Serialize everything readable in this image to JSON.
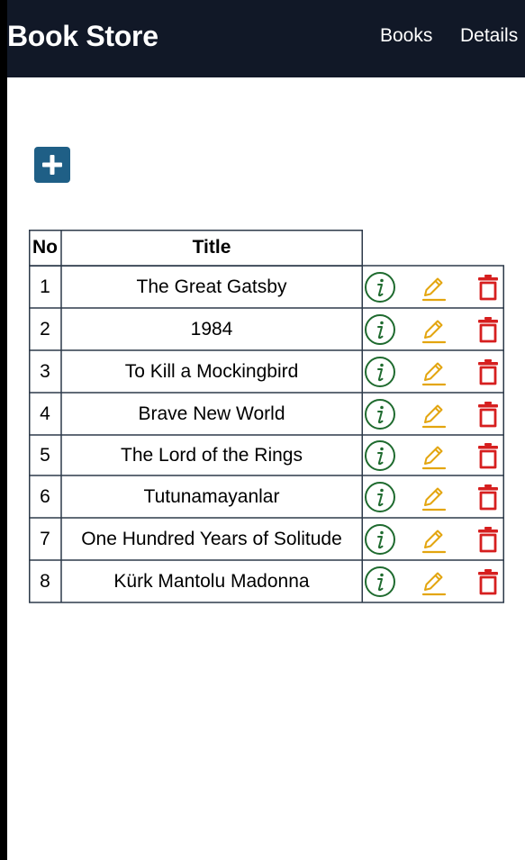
{
  "app": {
    "brand": "Book Store",
    "nav": [
      {
        "label": "Books"
      },
      {
        "label": "Details"
      }
    ]
  },
  "toolbar": {
    "add_icon": "plus-icon"
  },
  "table": {
    "headers": {
      "no": "No",
      "title": "Title"
    },
    "row_action_icons": [
      "info-icon",
      "pencil-icon",
      "trash-icon"
    ],
    "rows": [
      {
        "no": "1",
        "title": "The Great Gatsby"
      },
      {
        "no": "2",
        "title": "1984"
      },
      {
        "no": "3",
        "title": "To Kill a Mockingbird"
      },
      {
        "no": "4",
        "title": "Brave New World"
      },
      {
        "no": "5",
        "title": "The Lord of the Rings"
      },
      {
        "no": "6",
        "title": "Tutunamayanlar"
      },
      {
        "no": "7",
        "title": "One Hundred Years of Solitude"
      },
      {
        "no": "8",
        "title": "Kürk Mantolu Madonna"
      }
    ]
  },
  "colors": {
    "navbar": "#111827",
    "add_button": "#1f5f86",
    "info": "#1f6b2f",
    "edit": "#e3a50f",
    "delete": "#d61f1f",
    "border": "#2d3a4a"
  }
}
